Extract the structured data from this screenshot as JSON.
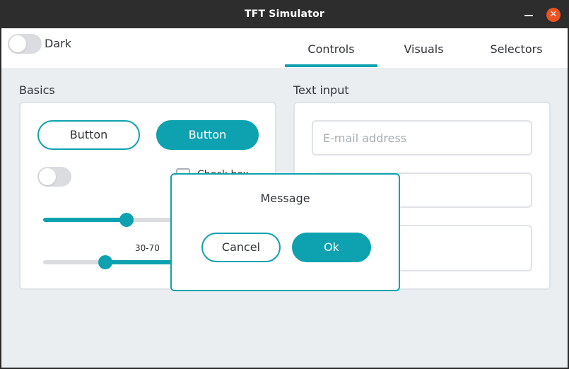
{
  "window": {
    "title": "TFT Simulator",
    "controls": {
      "minimize": "minimize-icon",
      "close": "close-icon",
      "close_glyph": "✕"
    }
  },
  "header": {
    "dark_toggle": {
      "label": "Dark",
      "on": false
    },
    "tabs": [
      {
        "label": "Controls",
        "active": true
      },
      {
        "label": "Visuals",
        "active": false
      },
      {
        "label": "Selectors",
        "active": false
      }
    ]
  },
  "basics": {
    "title": "Basics",
    "button_outline_label": "Button",
    "button_filled_label": "Button",
    "switch_on": false,
    "checkbox": {
      "label": "Check box",
      "checked": false
    },
    "slider": {
      "value_fraction": 0.4
    },
    "range_slider": {
      "label": "30-70",
      "low": 30,
      "high": 70
    }
  },
  "text_input": {
    "title": "Text input",
    "email": {
      "placeholder": "E-mail address",
      "value": ""
    },
    "field2": {
      "placeholder": "",
      "value": ""
    },
    "field3": {
      "placeholder": "",
      "value": ""
    }
  },
  "message_box": {
    "title": "Message",
    "cancel_label": "Cancel",
    "ok_label": "Ok"
  },
  "colors": {
    "accent": "#0ea2b0",
    "background": "#eaeef1",
    "titlebar": "#2d2d2d",
    "close_button": "#e95420"
  }
}
